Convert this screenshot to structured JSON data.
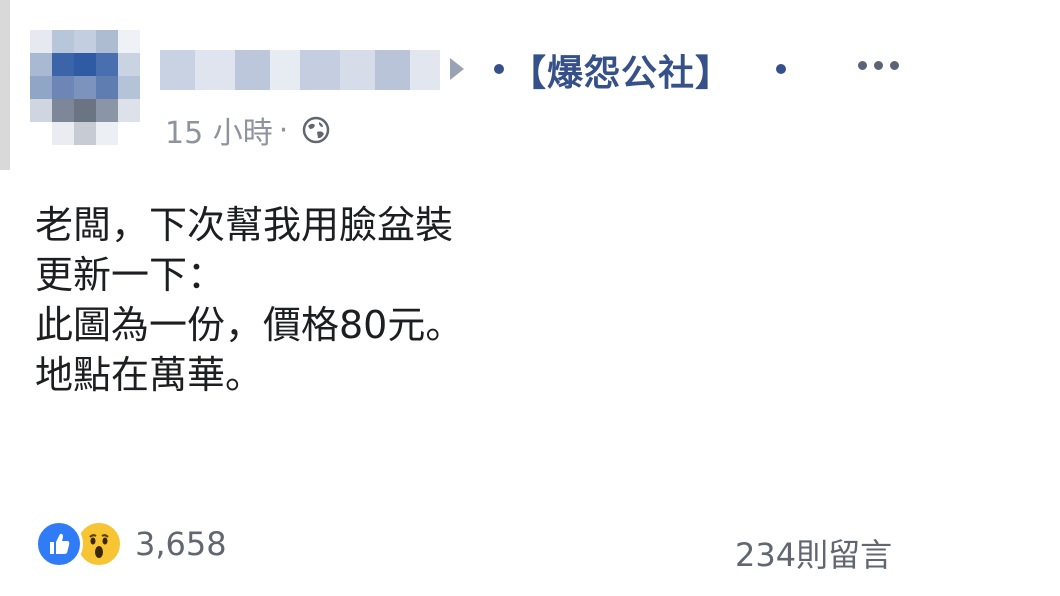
{
  "post": {
    "group_name": "【爆怨公社】",
    "timestamp": "15 小時",
    "separator": "·",
    "privacy_icon": "globe-icon",
    "lines": [
      "老闆，下次幫我用臉盆裝",
      "更新一下：",
      "此圖為一份，價格80元。",
      "地點在萬華。"
    ]
  },
  "footer": {
    "reaction_icons": [
      "like-icon",
      "wow-icon"
    ],
    "reaction_count": "3,658",
    "comment_count": "234則留言"
  },
  "colors": {
    "group_link": "#36508a",
    "meta_text": "#8d949e",
    "body_text": "#1c1e21",
    "like_blue": "#2f7cf6",
    "wow_yellow": "#f7c433"
  }
}
